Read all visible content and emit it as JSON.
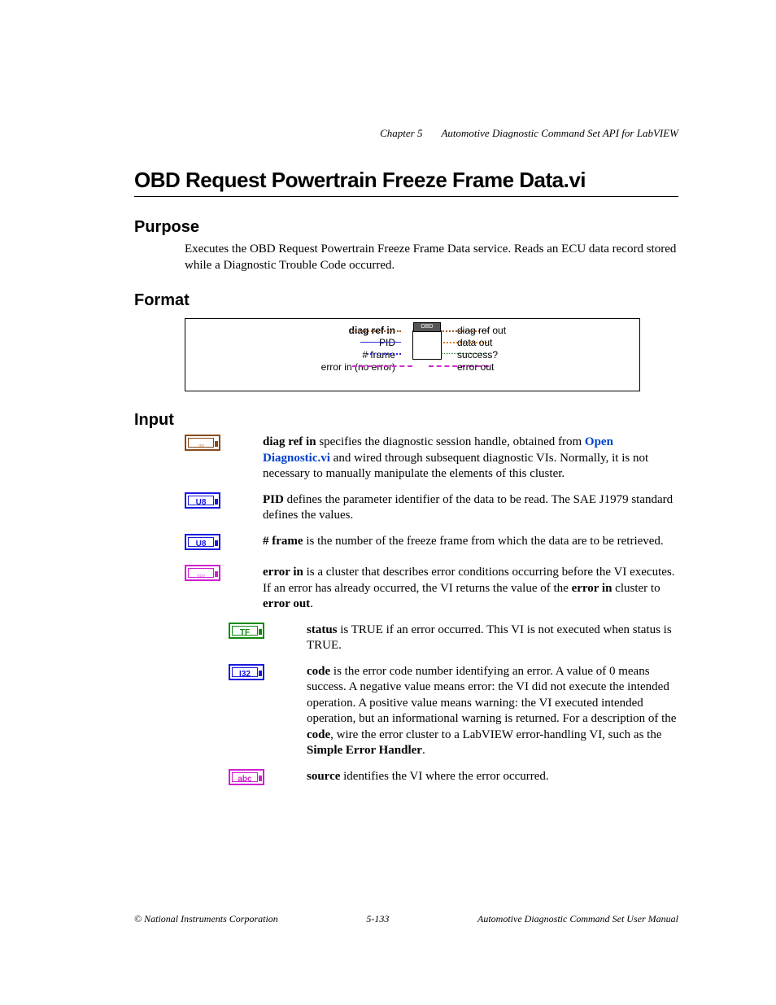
{
  "header": {
    "chapter": "Chapter 5",
    "section": "Automotive Diagnostic Command Set API for LabVIEW"
  },
  "title": "OBD Request Powertrain Freeze Frame Data.vi",
  "sections": {
    "purpose": {
      "heading": "Purpose",
      "text": "Executes the OBD Request Powertrain Freeze Frame Data service. Reads an ECU data record stored while a Diagnostic Trouble Code occurred."
    },
    "format": {
      "heading": "Format",
      "icon_label": "OBD",
      "left": {
        "l1": "diag ref in",
        "l2": "PID",
        "l3": "# frame",
        "l4": "error in (no error)"
      },
      "right": {
        "r1": "diag ref out",
        "r2": "data out",
        "r3": "success?",
        "r4": "error out"
      }
    },
    "input": {
      "heading": "Input",
      "diag_ref_in": {
        "label": "diag ref in",
        "text_before_link": " specifies the diagnostic session handle, obtained from ",
        "link": "Open Diagnostic.vi",
        "text_after_link": " and wired through subsequent diagnostic VIs. Normally, it is not necessary to manually manipulate the elements of this cluster."
      },
      "pid": {
        "label": "PID",
        "text": " defines the parameter identifier of the data to be read. The SAE J1979 standard defines the values."
      },
      "frame": {
        "label": "# frame",
        "text": " is the number of the freeze frame from which the data are to be retrieved."
      },
      "error_in": {
        "label": "error in",
        "text1": " is a cluster that describes error conditions occurring before the VI executes. If an error has already occurred, the VI returns the value of the ",
        "bold1": "error in",
        "text2": " cluster to ",
        "bold2": "error out",
        "text3": "."
      },
      "status": {
        "label": "status",
        "text": " is TRUE if an error occurred. This VI is not executed when status is TRUE."
      },
      "code": {
        "label": "code",
        "text1": " is the error code number identifying an error. A value of 0 means success. A negative value means error: the VI did not execute the intended operation. A positive value means warning: the VI executed intended operation, but an informational warning is returned. For a description of the ",
        "bold1": "code",
        "text2": ", wire the error cluster to a LabVIEW error-handling VI, such as the ",
        "bold2": "Simple Error Handler",
        "text3": "."
      },
      "source": {
        "label": "source",
        "text": " identifies the VI where the error occurred."
      }
    }
  },
  "icon_text": {
    "u8": "U8",
    "tf": "TF",
    "i32": "I32",
    "abc": "abc",
    "cluster": "▫▫▫",
    "error_cluster": "▫▫▫"
  },
  "footer": {
    "left": "© National Instruments Corporation",
    "center": "5-133",
    "right": "Automotive Diagnostic Command Set User Manual"
  }
}
